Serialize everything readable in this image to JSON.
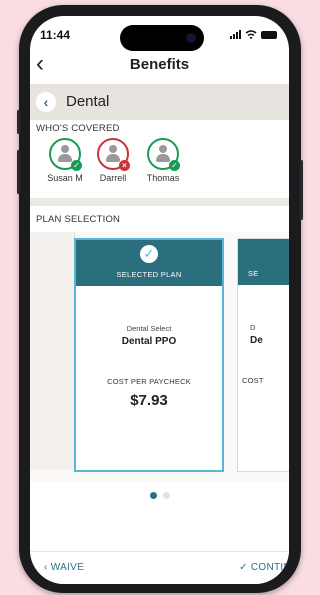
{
  "status_bar": {
    "time": "11:44"
  },
  "nav": {
    "back_icon": "chevron-left-icon",
    "title": "Benefits"
  },
  "breadcrumb": {
    "label": "Dental"
  },
  "coverage": {
    "label": "WHO'S COVERED",
    "members": [
      {
        "name": "Susan M",
        "status": "covered"
      },
      {
        "name": "Darrell",
        "status": "not-covered"
      },
      {
        "name": "Thomas",
        "status": "covered"
      }
    ]
  },
  "plans": {
    "label": "PLAN SELECTION",
    "selected": {
      "header": "SELECTED PLAN",
      "subtitle": "Dental Select",
      "name": "Dental PPO",
      "cost_label": "COST PER PAYCHECK",
      "cost": "$7.93"
    },
    "next_partial": {
      "header": "SE",
      "subtitle": "D",
      "name": "De",
      "cost_label": "COST"
    }
  },
  "pagination": {
    "current": 1,
    "total": 2
  },
  "footer": {
    "waive": "WAIVE",
    "continue": "CONTIN"
  },
  "colors": {
    "accent": "#2a6f8a",
    "card_header": "#2b6e7e",
    "selected_border": "#58b6d3",
    "covered": "#1a9a54",
    "not_covered": "#c9343a",
    "background": "#f9dde2"
  }
}
